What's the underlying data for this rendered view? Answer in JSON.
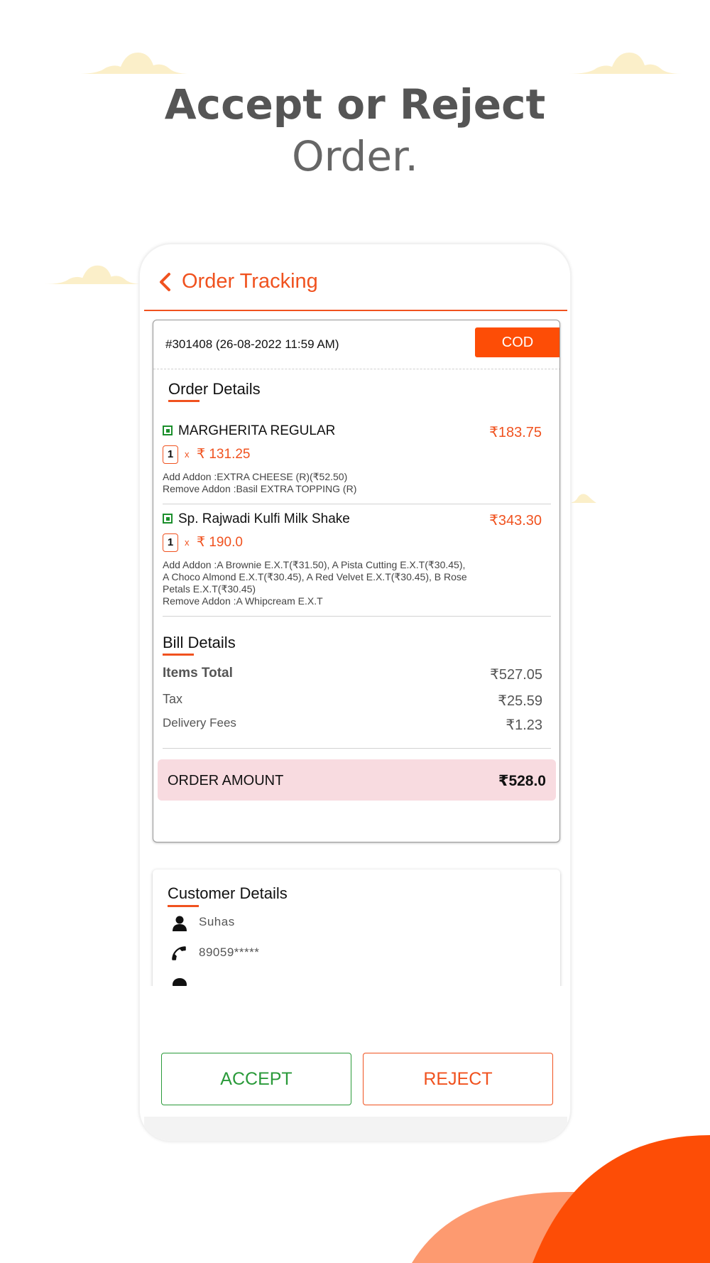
{
  "headline": {
    "line1": "Accept or Reject",
    "line2": "Order."
  },
  "colors": {
    "accent": "#f0521f",
    "badge": "#fd4d06",
    "accept": "#2a9a3a",
    "amount_bg": "#f8dbe0",
    "cloud": "#fbefc9"
  },
  "header": {
    "title": "Order Tracking",
    "back_icon": "chevron-left-icon"
  },
  "order": {
    "id_line": "#301408 (26-08-2022 11:59 AM)",
    "payment_badge": "COD",
    "details_title": "Order Details",
    "items": [
      {
        "name": "MARGHERITA REGULAR",
        "total": "₹183.75",
        "qty": "1",
        "x": "x",
        "unit_price": "₹ 131.25",
        "addon_lines": [
          "Add Addon :EXTRA CHEESE (R)(₹52.50)",
          "Remove Addon :Basil EXTRA TOPPING (R)"
        ]
      },
      {
        "name": "Sp. Rajwadi Kulfi Milk Shake",
        "total": "₹343.30",
        "qty": "1",
        "x": "x",
        "unit_price": "₹ 190.0",
        "addon_lines": [
          "Add Addon :A Brownie E.X.T(₹31.50), A Pista Cutting E.X.T(₹30.45),",
          "A Choco Almond E.X.T(₹30.45), A Red Velvet E.X.T(₹30.45), B Rose",
          "Petals E.X.T(₹30.45)",
          "Remove Addon :A Whipcream E.X.T"
        ]
      }
    ],
    "bill": {
      "title": "Bill Details",
      "items_total_label": "Items Total",
      "items_total_value": "₹527.05",
      "tax_label": "Tax",
      "tax_value": "₹25.59",
      "delivery_label": "Delivery Fees",
      "delivery_value": "₹1.23"
    },
    "amount": {
      "label": "ORDER AMOUNT",
      "value": "₹528.0"
    }
  },
  "customer": {
    "title": "Customer Details",
    "name": "Suhas",
    "phone": "89059*****"
  },
  "actions": {
    "accept": "ACCEPT",
    "reject": "REJECT"
  }
}
